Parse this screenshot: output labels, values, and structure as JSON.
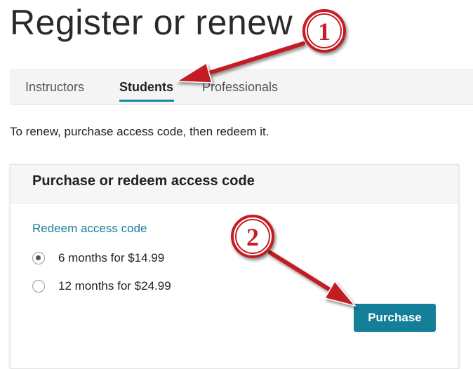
{
  "header": {
    "title": "Register or renew"
  },
  "tabs": [
    {
      "label": "Instructors",
      "active": false
    },
    {
      "label": "Students",
      "active": true
    },
    {
      "label": "Professionals",
      "active": false
    }
  ],
  "intro_text": "To renew, purchase access code, then redeem it.",
  "card": {
    "title": "Purchase or redeem access code",
    "redeem_link": "Redeem access code",
    "options": [
      {
        "label": "6 months for $14.99",
        "selected": true
      },
      {
        "label": "12 months for $24.99",
        "selected": false
      }
    ],
    "purchase_label": "Purchase"
  },
  "annotations": {
    "step1": "1",
    "step2": "2",
    "color": "#c31f24"
  },
  "colors": {
    "accent": "#137f99",
    "tab_underline": "#17879c",
    "annotation_red": "#c31f24"
  }
}
